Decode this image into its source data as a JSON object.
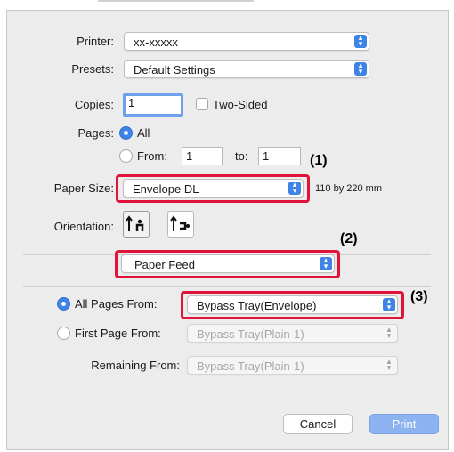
{
  "printer": {
    "label": "Printer:",
    "value": "xx-xxxxx"
  },
  "presets": {
    "label": "Presets:",
    "value": "Default Settings"
  },
  "copies": {
    "label": "Copies:",
    "value": "1",
    "two_sided_label": "Two-Sided",
    "two_sided_checked": false
  },
  "pages": {
    "label": "Pages:",
    "all_label": "All",
    "from_label": "From:",
    "from_value": "1",
    "to_label": "to:",
    "to_value": "1",
    "selected": "All"
  },
  "paper_size": {
    "label": "Paper Size:",
    "value": "Envelope DL",
    "dimensions": "110 by 220 mm"
  },
  "orientation": {
    "label": "Orientation:",
    "selected": "portrait",
    "options": [
      "portrait-icon",
      "landscape-icon"
    ]
  },
  "section_menu": {
    "value": "Paper Feed"
  },
  "paper_feed": {
    "all_pages_label": "All Pages From:",
    "all_pages_value": "Bypass Tray(Envelope)",
    "first_page_label": "First Page From:",
    "first_page_value": "Bypass Tray(Plain-1)",
    "remaining_label": "Remaining From:",
    "remaining_value": "Bypass Tray(Plain-1)",
    "selected": "All Pages From"
  },
  "callouts": [
    "(1)",
    "(2)",
    "(3)"
  ],
  "buttons": {
    "cancel": "Cancel",
    "print": "Print"
  },
  "colors": {
    "accent": "#3d84e6",
    "highlight_box": "#e0133a",
    "dialog_bg": "#ececec"
  }
}
